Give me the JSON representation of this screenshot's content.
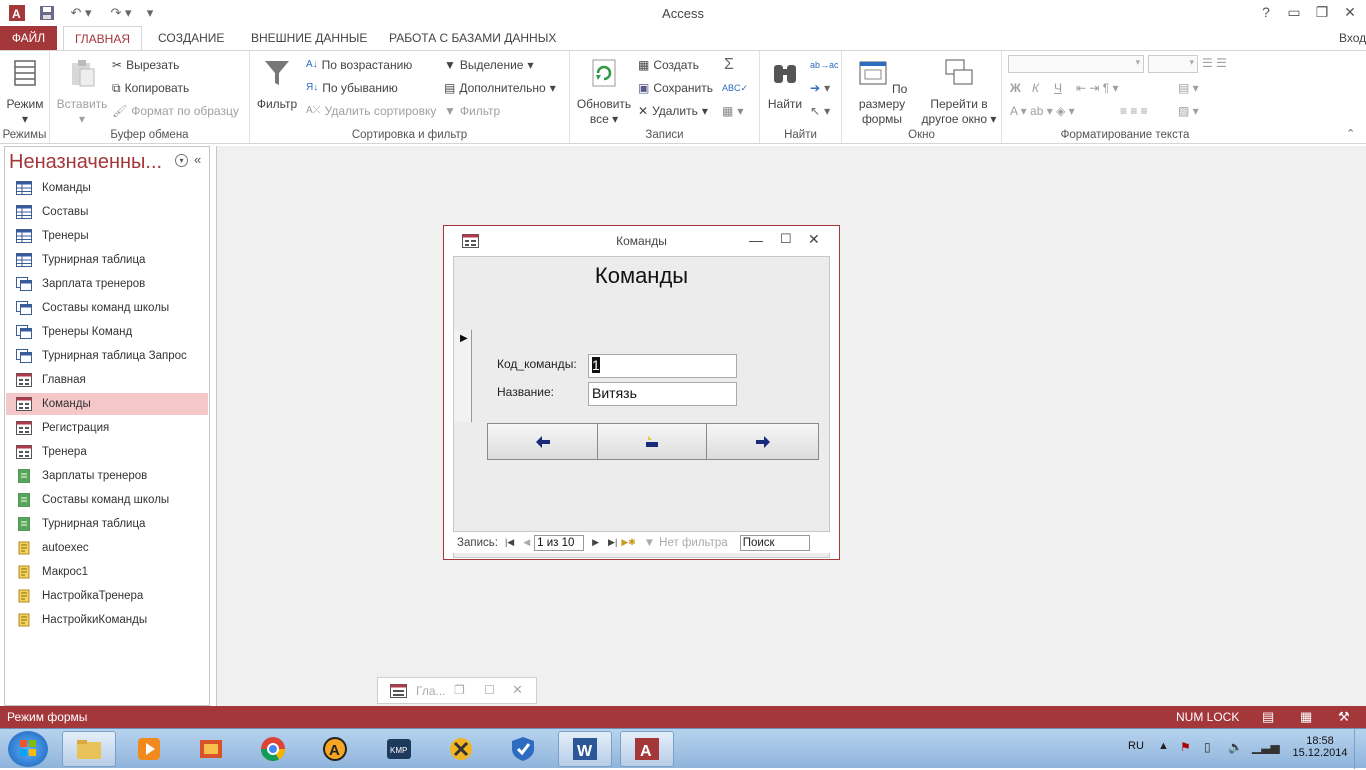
{
  "app": {
    "title": "Access",
    "signin": "Вход"
  },
  "tabs": [
    "ФАЙЛ",
    "ГЛАВНАЯ",
    "СОЗДАНИЕ",
    "ВНЕШНИЕ ДАННЫЕ",
    "РАБОТА С БАЗАМИ ДАННЫХ"
  ],
  "ribbon": {
    "views": {
      "mode": "Режим",
      "label": "Режимы"
    },
    "clipboard": {
      "paste": "Вставить",
      "cut": "Вырезать",
      "copy": "Копировать",
      "format_painter": "Формат по образцу",
      "label": "Буфер обмена"
    },
    "sort": {
      "filter": "Фильтр",
      "asc": "По возрастанию",
      "desc": "По убыванию",
      "remove": "Удалить сортировку",
      "selection": "Выделение",
      "advanced": "Дополнительно",
      "toggle": "Фильтр",
      "label": "Сортировка и фильтр"
    },
    "records": {
      "refresh1": "Обновить",
      "refresh2": "все",
      "new": "Создать",
      "save": "Сохранить",
      "delete": "Удалить",
      "label": "Записи"
    },
    "find": {
      "find": "Найти",
      "label": "Найти"
    },
    "window": {
      "fit1": "По размеру",
      "fit2": "формы",
      "switch1": "Перейти в",
      "switch2": "другое окно",
      "label": "Окно"
    },
    "text": {
      "bold": "Ж",
      "italic": "К",
      "underline": "Ч",
      "label": "Форматирование текста"
    }
  },
  "nav": {
    "title": "Неназначенны...",
    "items": [
      {
        "label": "Команды",
        "type": "table"
      },
      {
        "label": "Составы",
        "type": "table"
      },
      {
        "label": "Тренеры",
        "type": "table"
      },
      {
        "label": "Турнирная таблица",
        "type": "table"
      },
      {
        "label": "Зарплата тренеров",
        "type": "query"
      },
      {
        "label": "Составы команд школы",
        "type": "query"
      },
      {
        "label": "Тренеры Команд",
        "type": "query"
      },
      {
        "label": "Турнирная таблица Запрос",
        "type": "query"
      },
      {
        "label": "Главная",
        "type": "form"
      },
      {
        "label": "Команды",
        "type": "form",
        "selected": true
      },
      {
        "label": "Регистрация",
        "type": "form"
      },
      {
        "label": "Тренера",
        "type": "form"
      },
      {
        "label": "Зарплаты тренеров",
        "type": "report"
      },
      {
        "label": "Составы команд школы",
        "type": "report"
      },
      {
        "label": "Турнирная таблица",
        "type": "report"
      },
      {
        "label": "autoexec",
        "type": "macro"
      },
      {
        "label": "Макрос1",
        "type": "macro"
      },
      {
        "label": "НастройкаТренера",
        "type": "macro"
      },
      {
        "label": "НастройкиКоманды",
        "type": "macro"
      }
    ]
  },
  "form": {
    "window_title": "Команды",
    "heading": "Команды",
    "code_label": "Код_команды:",
    "code_value": "1",
    "name_label": "Название:",
    "name_value": "Витязь",
    "record_label": "Запись:",
    "record_pos": "1 из 10",
    "no_filter": "Нет фильтра",
    "search": "Поиск"
  },
  "minimized": {
    "title": "Гла..."
  },
  "status": {
    "mode": "Режим формы",
    "numlock": "NUM LOCK"
  },
  "taskbar": {
    "lang": "RU",
    "time": "18:58",
    "date": "15.12.2014"
  },
  "colors": {
    "accent": "#a4373a",
    "selection": "#f4c7c8"
  }
}
